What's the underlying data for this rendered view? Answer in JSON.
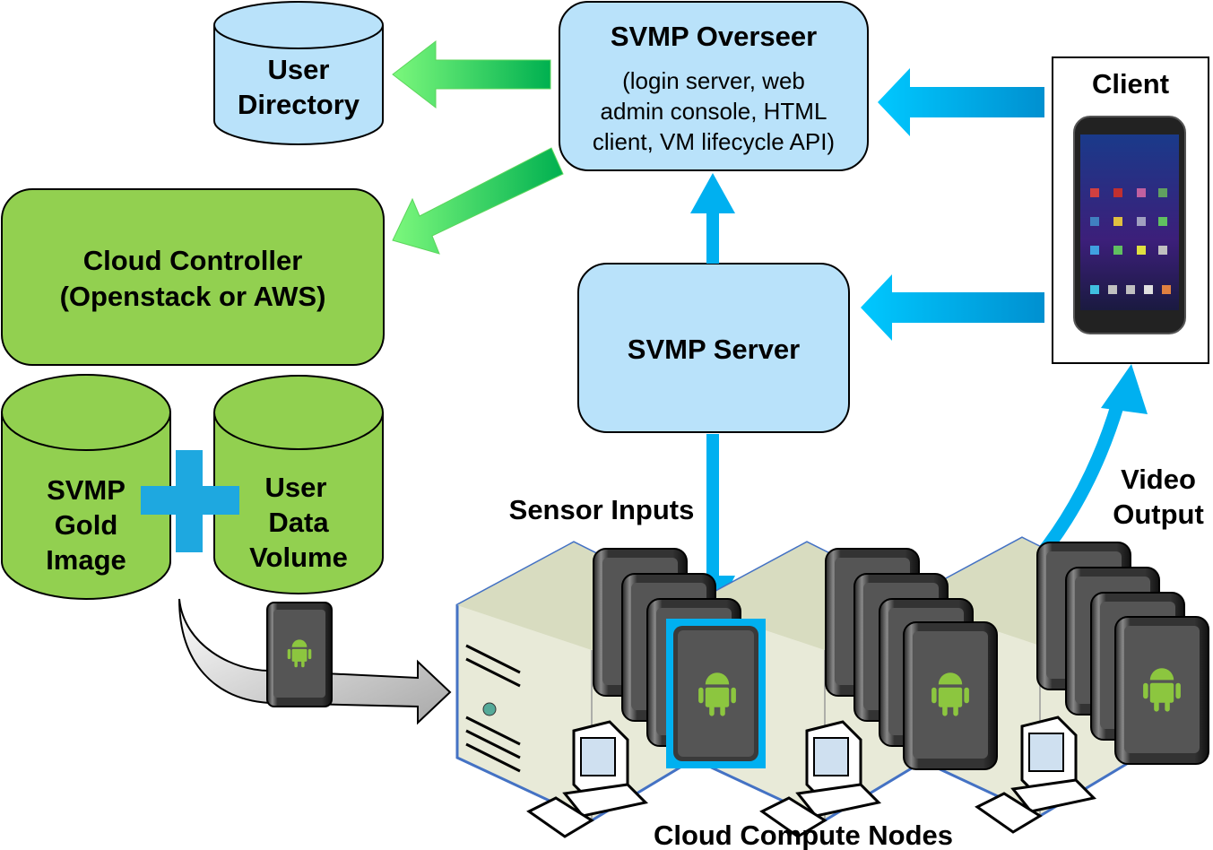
{
  "nodes": {
    "user_directory": [
      "User",
      "Directory"
    ],
    "overseer": {
      "title": "SVMP Overseer",
      "lines": [
        "(login server, web",
        "admin console, HTML",
        "client, VM lifecycle API)"
      ]
    },
    "client": "Client",
    "cloud_controller": [
      "Cloud Controller",
      "(Openstack or AWS)"
    ],
    "gold_image": [
      "SVMP",
      "Gold",
      "Image"
    ],
    "user_data_volume": [
      "User",
      "Data",
      "Volume"
    ],
    "svmp_server": "SVMP Server",
    "cloud_compute_nodes": "Cloud Compute Nodes"
  },
  "labels": {
    "sensor_inputs": "Sensor Inputs",
    "video_output": [
      "Video",
      "Output"
    ]
  },
  "colors": {
    "light_blue": "#b9e2fa",
    "green": "#92d050",
    "arrow_blue": "#00b0f0",
    "arrow_green": "#3ee03e",
    "android_green": "#8cc63f"
  }
}
